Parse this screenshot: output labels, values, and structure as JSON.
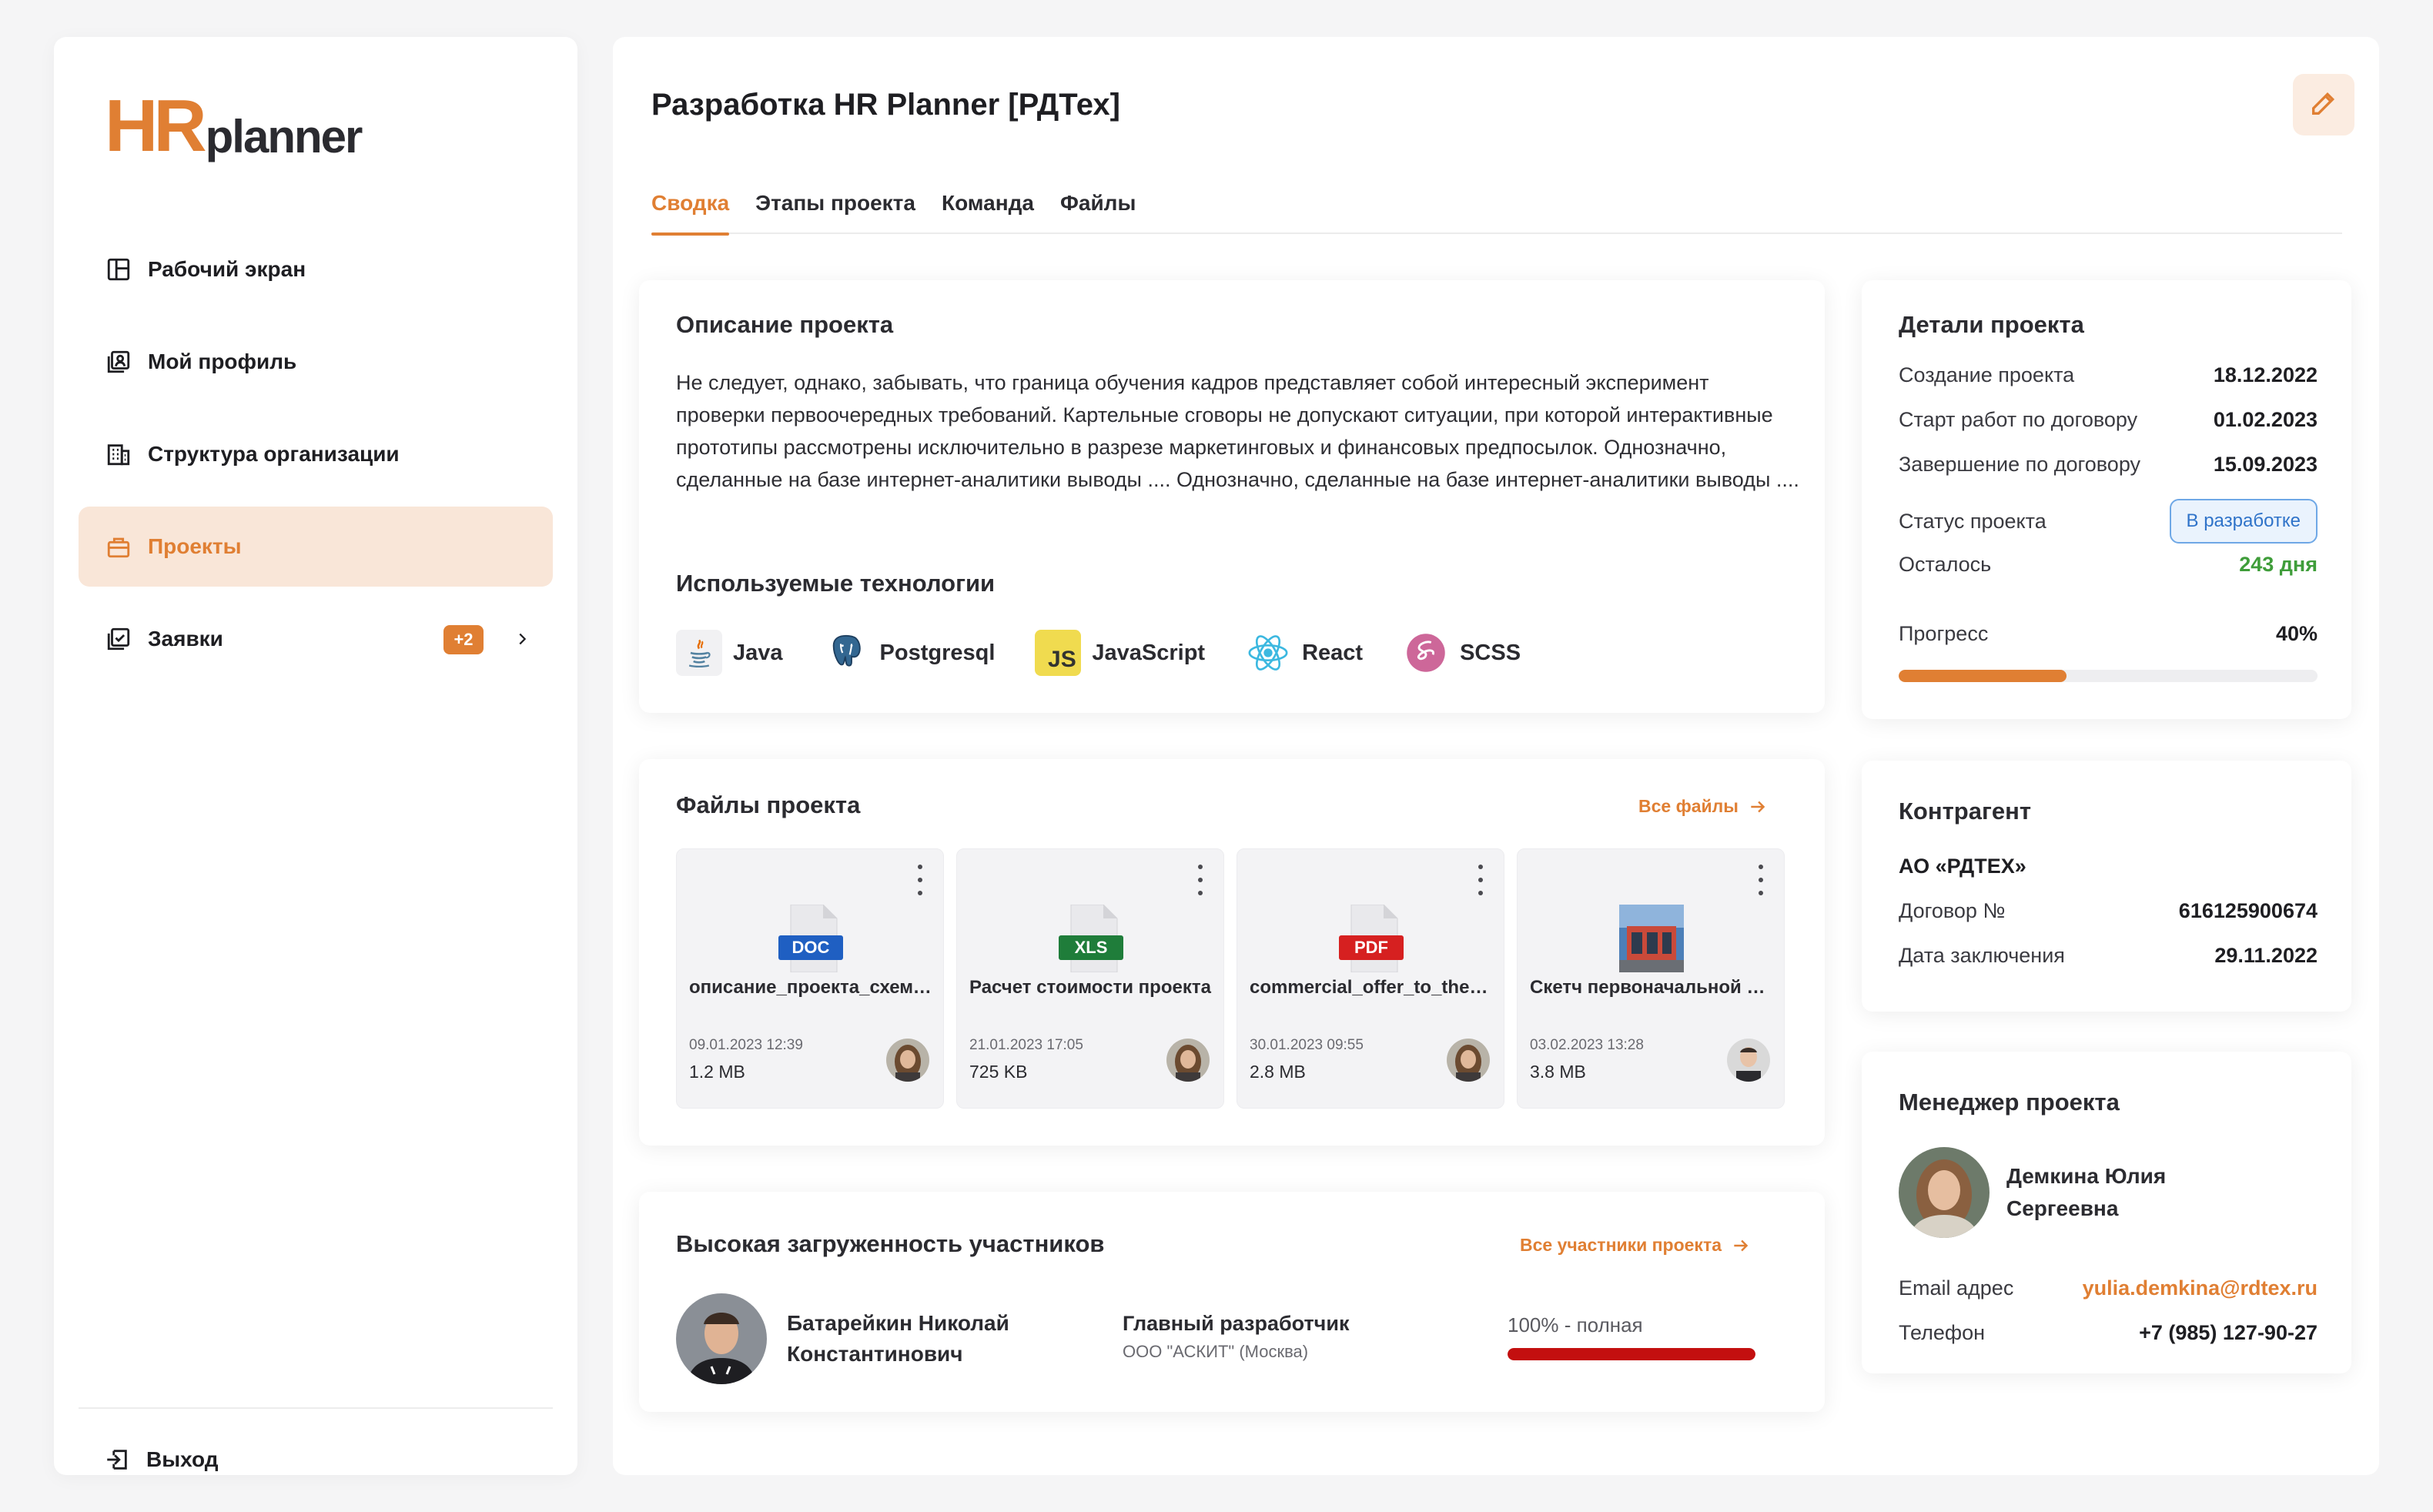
{
  "brand": {
    "hr": "HR",
    "planner": "planner"
  },
  "sidebar": {
    "items": [
      {
        "label": "Рабочий экран",
        "icon": "dashboard-icon"
      },
      {
        "label": "Мой профиль",
        "icon": "profile-icon"
      },
      {
        "label": "Структура организации",
        "icon": "building-icon"
      },
      {
        "label": "Проекты",
        "icon": "briefcase-icon",
        "active": true
      },
      {
        "label": "Заявки",
        "icon": "checklist-icon",
        "badge": "+2"
      }
    ],
    "logout": "Выход"
  },
  "page": {
    "title": "Разработка HR Planner [РДТех]",
    "tabs": [
      "Сводка",
      "Этапы проекта",
      "Команда",
      "Файлы"
    ],
    "active_tab": "Сводка"
  },
  "description": {
    "title": "Описание проекта",
    "text": "Не следует, однако, забывать, что граница обучения кадров представляет собой интересный эксперимент проверки первоочередных требований. Картельные сговоры не допускают ситуации, при которой интерактивные прототипы рассмотрены исключительно в разрезе маркетинговых и финансовых предпосылок. Однозначно, сделанные на базе интернет-аналитики выводы .... Однозначно, сделанные на базе интернет-аналитики выводы ....",
    "tech_title": "Используемые технологии",
    "technologies": [
      "Java",
      "Postgresql",
      "JavaScript",
      "React",
      "SCSS"
    ]
  },
  "files": {
    "title": "Файлы проекта",
    "all_link": "Все файлы",
    "items": [
      {
        "type": "DOC",
        "name": "описание_проекта_схема_взаимодействия.doc",
        "date": "09.01.2023 12:39",
        "size": "1.2 MB",
        "color": "#1f5fc2"
      },
      {
        "type": "XLS",
        "name": "Расчет стоимости проекта",
        "date": "21.01.2023 17:05",
        "size": "725 KB",
        "color": "#1f7d3a"
      },
      {
        "type": "PDF",
        "name": "commercial_offer_to_the_client.pdf",
        "date": "30.01.2023 09:55",
        "size": "2.8 MB",
        "color": "#d62020"
      },
      {
        "type": "IMG",
        "name": "Скетч первоначальной версии",
        "date": "03.02.2023 13:28",
        "size": "3.8 MB",
        "color": "#3a6fb0"
      }
    ]
  },
  "load": {
    "title": "Высокая загруженность участников",
    "all_link": "Все участники проекта",
    "member": {
      "name_line1": "Батарейкин Николай",
      "name_line2": "Константинович",
      "role": "Главный разработчик",
      "company": "ООО \"АСКИТ\" (Москва)",
      "load_text": "100% - полная",
      "load_percent": 100
    }
  },
  "details": {
    "title": "Детали проекта",
    "created_label": "Создание проекта",
    "created": "18.12.2022",
    "start_label": "Старт работ по договору",
    "start": "01.02.2023",
    "end_label": "Завершение по договору",
    "end": "15.09.2023",
    "status_label": "Статус проекта",
    "status": "В разработке",
    "remaining_label": "Осталось",
    "remaining": "243 дня",
    "progress_label": "Прогресс",
    "progress": "40%",
    "progress_value": 40
  },
  "contractor": {
    "title": "Контрагент",
    "name": "АО «РДТЕХ»",
    "contract_label": "Договор №",
    "contract": "616125900674",
    "date_label": "Дата заключения",
    "date": "29.11.2022"
  },
  "manager": {
    "title": "Менеджер проекта",
    "name_line1": "Демкина Юлия",
    "name_line2": "Сергеевна",
    "email_label": "Email адрес",
    "email": "yulia.demkina@rdtex.ru",
    "phone_label": "Телефон",
    "phone": "+7 (985) 127-90-27"
  },
  "colors": {
    "accent": "#e07f33",
    "status_blue": "#2f73c9",
    "positive": "#3f9d3a",
    "danger": "#c30f0f"
  }
}
